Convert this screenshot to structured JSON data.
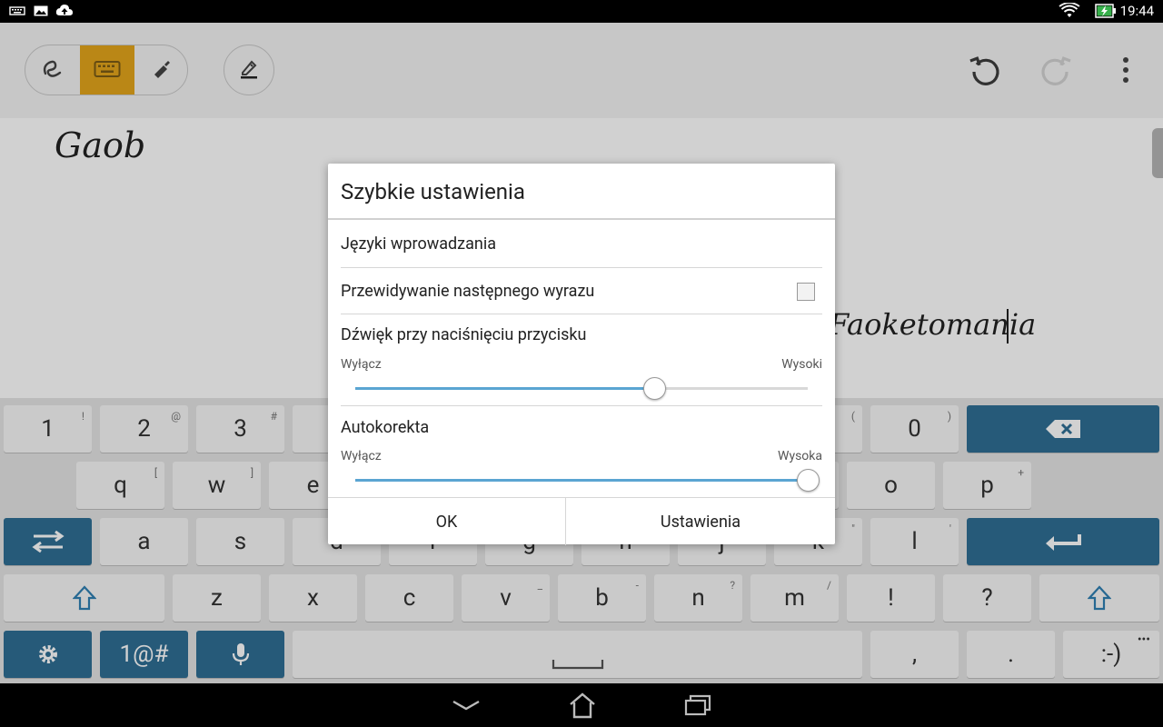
{
  "status_bar": {
    "time": "19:44"
  },
  "canvas": {
    "handwriting_1": "Gaob",
    "handwriting_2": "Faoketomania"
  },
  "keyboard": {
    "rows": [
      [
        {
          "main": "1",
          "alt": "!"
        },
        {
          "main": "2",
          "alt": "@"
        },
        {
          "main": "3",
          "alt": "#"
        },
        {
          "main": "",
          "alt": ""
        },
        {
          "main": "",
          "alt": ""
        },
        {
          "main": "",
          "alt": ""
        },
        {
          "main": "",
          "alt": ""
        },
        {
          "main": "",
          "alt": ""
        },
        {
          "main": "",
          "alt": "("
        },
        {
          "main": "0",
          "alt": ")"
        }
      ],
      [
        {
          "main": "q",
          "alt": "["
        },
        {
          "main": "w",
          "alt": "]"
        },
        {
          "main": "e",
          "alt": ""
        },
        {
          "main": "",
          "alt": ""
        },
        {
          "main": "",
          "alt": ""
        },
        {
          "main": "",
          "alt": ""
        },
        {
          "main": "",
          "alt": ""
        },
        {
          "main": "",
          "alt": ""
        },
        {
          "main": "o",
          "alt": ""
        },
        {
          "main": "p",
          "alt": "+"
        }
      ],
      [
        {
          "main": "a",
          "alt": ""
        },
        {
          "main": "s",
          "alt": ""
        },
        {
          "main": "d",
          "alt": ""
        },
        {
          "main": "f",
          "alt": ""
        },
        {
          "main": "g",
          "alt": ""
        },
        {
          "main": "h",
          "alt": ""
        },
        {
          "main": "j",
          "alt": ""
        },
        {
          "main": "k",
          "alt": "\""
        },
        {
          "main": "l",
          "alt": "'"
        }
      ],
      [
        {
          "main": "z",
          "alt": ""
        },
        {
          "main": "x",
          "alt": ""
        },
        {
          "main": "c",
          "alt": ""
        },
        {
          "main": "v",
          "alt": "_"
        },
        {
          "main": "b",
          "alt": "-"
        },
        {
          "main": "n",
          "alt": "?"
        },
        {
          "main": "m",
          "alt": "/"
        },
        {
          "main": "!",
          "alt": ""
        },
        {
          "main": "?",
          "alt": ""
        }
      ]
    ],
    "symbols_label": "1@#",
    "comma": ",",
    "period": ".",
    "smiley": ":-)"
  },
  "dialog": {
    "title": "Szybkie ustawienia",
    "input_languages": "Języki wprowadzania",
    "next_word_prediction": "Przewidywanie następnego wyrazu",
    "next_word_prediction_checked": false,
    "key_sound": {
      "label": "Dźwięk przy naciśnięciu przycisku",
      "min_label": "Wyłącz",
      "max_label": "Wysoki",
      "level": 0.66
    },
    "autocorrect": {
      "label": "Autokorekta",
      "min_label": "Wyłącz",
      "max_label": "Wysoka",
      "level": 1.0
    },
    "ok_label": "OK",
    "settings_label": "Ustawienia"
  },
  "colors": {
    "active_tool": "#e3a51c",
    "keyboard_blue": "#2f6e94",
    "slider_accent": "#5aa5d2"
  },
  "icons": {
    "toolbar": [
      "handwriting-icon",
      "keyboard-icon",
      "pen-icon",
      "eraser-edit-icon",
      "undo-icon",
      "redo-icon",
      "overflow-menu-icon"
    ],
    "status": [
      "keyboard-status-icon",
      "gallery-icon",
      "cloud-upload-icon",
      "wifi-icon",
      "battery-charging-icon"
    ],
    "nav": [
      "back-icon",
      "home-icon",
      "recents-icon"
    ]
  }
}
